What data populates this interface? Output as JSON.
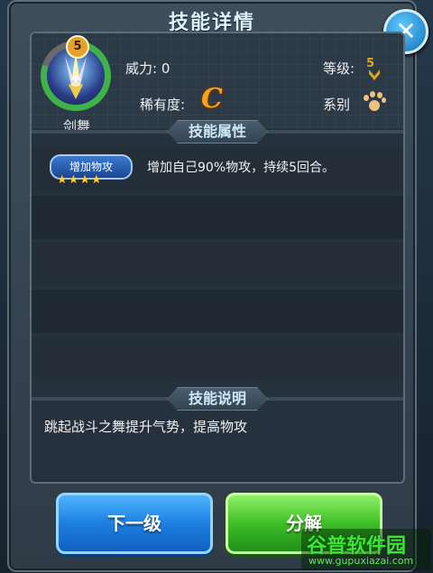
{
  "dialog": {
    "title": "技能详情",
    "close_icon": "close-icon"
  },
  "skill": {
    "level": "5",
    "name": "剑舞",
    "power_label": "威力: 0",
    "grade_label": "等级:",
    "grade_value": "5",
    "rarity_label": "稀有度:",
    "rarity_value": "C",
    "type_label": "系别",
    "type_icon": "paw-icon"
  },
  "attributes": {
    "title": "技能属性",
    "effects": [
      {
        "tag": "增加物攻",
        "stars": "★★★★",
        "star_count": 4,
        "description": "增加自己90%物攻，持续5回合。"
      }
    ]
  },
  "description_section": {
    "title": "技能说明",
    "text": "跳起战斗之舞提升气势，提高物攻"
  },
  "buttons": {
    "next_level": "下一级",
    "decompose": "分解"
  },
  "watermark": {
    "main": "谷普软件园",
    "sub": "www.gupuxiazai.com"
  },
  "colors": {
    "rarity": "#f6a21a",
    "next_button": "#1d7fe0",
    "decompose_button": "#3ebf25",
    "star": "#ffd22b"
  }
}
